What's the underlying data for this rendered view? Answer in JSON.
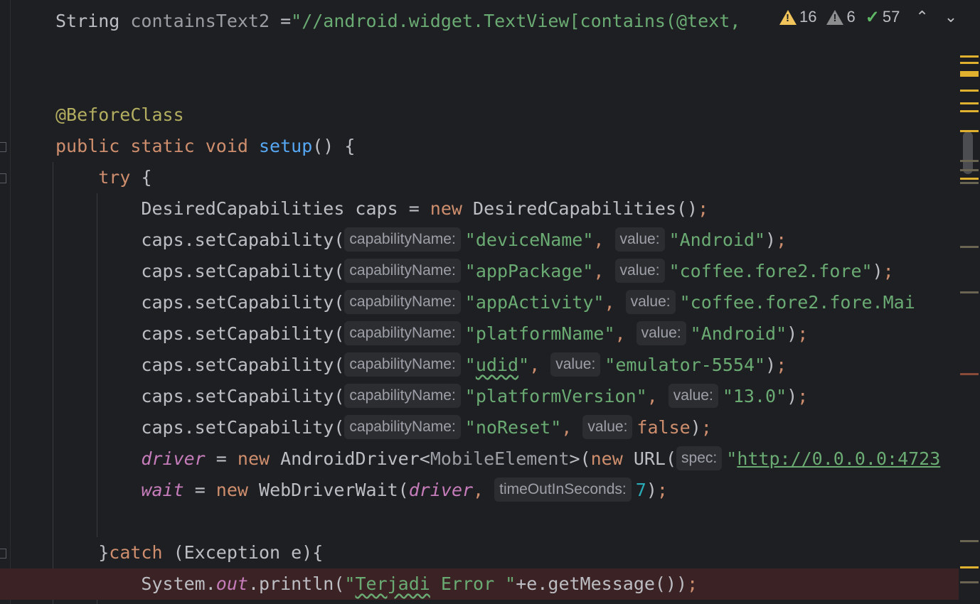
{
  "editor": {
    "lines": [
      {
        "segs": [
          [
            "plain",
            "String "
          ],
          [
            "gray",
            "containsText2 "
          ],
          [
            "plain",
            "="
          ],
          [
            "str",
            "\"//android.widget.TextView[contains(@text, "
          ]
        ]
      },
      {
        "segs": []
      },
      {
        "segs": []
      },
      {
        "segs": [
          [
            "ann",
            "@BeforeClass"
          ]
        ]
      },
      {
        "segs": [
          [
            "kw",
            "public static void "
          ],
          [
            "fn",
            "setup"
          ],
          [
            "plain",
            "() {"
          ]
        ]
      },
      {
        "segs": [
          [
            "plain",
            "    "
          ],
          [
            "kw",
            "try "
          ],
          [
            "plain",
            "{"
          ]
        ]
      },
      {
        "segs": [
          [
            "plain",
            "        DesiredCapabilities caps = "
          ],
          [
            "kw",
            "new "
          ],
          [
            "plain",
            "DesiredCapabilities()"
          ],
          [
            "kw",
            ";"
          ]
        ]
      },
      {
        "segs": [
          [
            "plain",
            "        caps.setCapability("
          ],
          [
            "hint",
            "capabilityName:"
          ],
          [
            "str",
            "\"deviceName\""
          ],
          [
            "kw",
            ", "
          ],
          [
            "hint",
            "value:"
          ],
          [
            "str",
            "\"Android\""
          ],
          [
            "plain",
            ")"
          ],
          [
            "kw",
            ";"
          ]
        ]
      },
      {
        "segs": [
          [
            "plain",
            "        caps.setCapability("
          ],
          [
            "hint",
            "capabilityName:"
          ],
          [
            "str",
            "\"appPackage\""
          ],
          [
            "kw",
            ", "
          ],
          [
            "hint",
            "value:"
          ],
          [
            "str",
            "\"coffee.fore2.fore\""
          ],
          [
            "plain",
            ")"
          ],
          [
            "kw",
            ";"
          ]
        ]
      },
      {
        "segs": [
          [
            "plain",
            "        caps.setCapability("
          ],
          [
            "hint",
            "capabilityName:"
          ],
          [
            "str",
            "\"appActivity\""
          ],
          [
            "kw",
            ", "
          ],
          [
            "hint",
            "value:"
          ],
          [
            "str",
            "\"coffee.fore2.fore.Mai"
          ]
        ]
      },
      {
        "segs": [
          [
            "plain",
            "        caps.setCapability("
          ],
          [
            "hint",
            "capabilityName:"
          ],
          [
            "str",
            "\"platformName\""
          ],
          [
            "kw",
            ", "
          ],
          [
            "hint",
            "value:"
          ],
          [
            "str",
            "\"Android\""
          ],
          [
            "plain",
            ")"
          ],
          [
            "kw",
            ";"
          ]
        ]
      },
      {
        "segs": [
          [
            "plain",
            "        caps.setCapability("
          ],
          [
            "hint",
            "capabilityName:"
          ],
          [
            "str",
            "\""
          ],
          [
            "strtypo",
            "udid"
          ],
          [
            "str",
            "\""
          ],
          [
            "kw",
            ", "
          ],
          [
            "hint",
            "value:"
          ],
          [
            "str",
            "\"emulator-5554\""
          ],
          [
            "plain",
            ")"
          ],
          [
            "kw",
            ";"
          ]
        ]
      },
      {
        "segs": [
          [
            "plain",
            "        caps.setCapability("
          ],
          [
            "hint",
            "capabilityName:"
          ],
          [
            "str",
            "\"platformVersion\""
          ],
          [
            "kw",
            ", "
          ],
          [
            "hint",
            "value:"
          ],
          [
            "str",
            "\"13.0\""
          ],
          [
            "plain",
            ")"
          ],
          [
            "kw",
            ";"
          ]
        ]
      },
      {
        "segs": [
          [
            "plain",
            "        caps.setCapability("
          ],
          [
            "hint",
            "capabilityName:"
          ],
          [
            "str",
            "\"noReset\""
          ],
          [
            "kw",
            ", "
          ],
          [
            "hint",
            "value:"
          ],
          [
            "kw",
            "false"
          ],
          [
            "plain",
            ")"
          ],
          [
            "kw",
            ";"
          ]
        ]
      },
      {
        "segs": [
          [
            "plain",
            "        "
          ],
          [
            "fld",
            "driver"
          ],
          [
            "plain",
            " = "
          ],
          [
            "kw",
            "new "
          ],
          [
            "plain",
            "AndroidDriver<"
          ],
          [
            "gray",
            "MobileElement"
          ],
          [
            "plain",
            ">("
          ],
          [
            "kw",
            "new "
          ],
          [
            "plain",
            "URL("
          ],
          [
            "hint",
            "spec:"
          ],
          [
            "str",
            "\""
          ],
          [
            "link",
            "http://0.0.0.0:4723"
          ]
        ]
      },
      {
        "segs": [
          [
            "plain",
            "        "
          ],
          [
            "fld",
            "wait"
          ],
          [
            "plain",
            " = "
          ],
          [
            "kw",
            "new "
          ],
          [
            "plain",
            "WebDriverWait("
          ],
          [
            "fld",
            "driver"
          ],
          [
            "kw",
            ", "
          ],
          [
            "hint",
            "timeOutInSeconds:"
          ],
          [
            "num",
            "7"
          ],
          [
            "plain",
            ")"
          ],
          [
            "kw",
            ";"
          ]
        ]
      },
      {
        "segs": []
      },
      {
        "segs": [
          [
            "plain",
            "    }"
          ],
          [
            "kw",
            "catch "
          ],
          [
            "plain",
            "(Exception e){"
          ]
        ]
      },
      {
        "segs": [
          [
            "plain",
            "        System."
          ],
          [
            "fld",
            "out"
          ],
          [
            "plain",
            ".println("
          ],
          [
            "str",
            "\""
          ],
          [
            "strtypo",
            "Terjadi"
          ],
          [
            "str",
            " Error \""
          ],
          [
            "plain",
            "+e.getMessage())"
          ],
          [
            "kw",
            ";"
          ]
        ],
        "error": true
      }
    ]
  },
  "toolbar": {
    "warnings_count": "16",
    "weak_warnings_count": "6",
    "typos_count": "57",
    "prev_label": "⌃",
    "next_label": "⌄"
  },
  "colors": {
    "background": "#1e1f22",
    "keyword": "#cf8e6d",
    "string": "#6aab73",
    "annotation": "#b3ae60",
    "function": "#56a8f5",
    "field": "#c77dbb",
    "number": "#2aacb8",
    "warning": "#f2c55c"
  }
}
